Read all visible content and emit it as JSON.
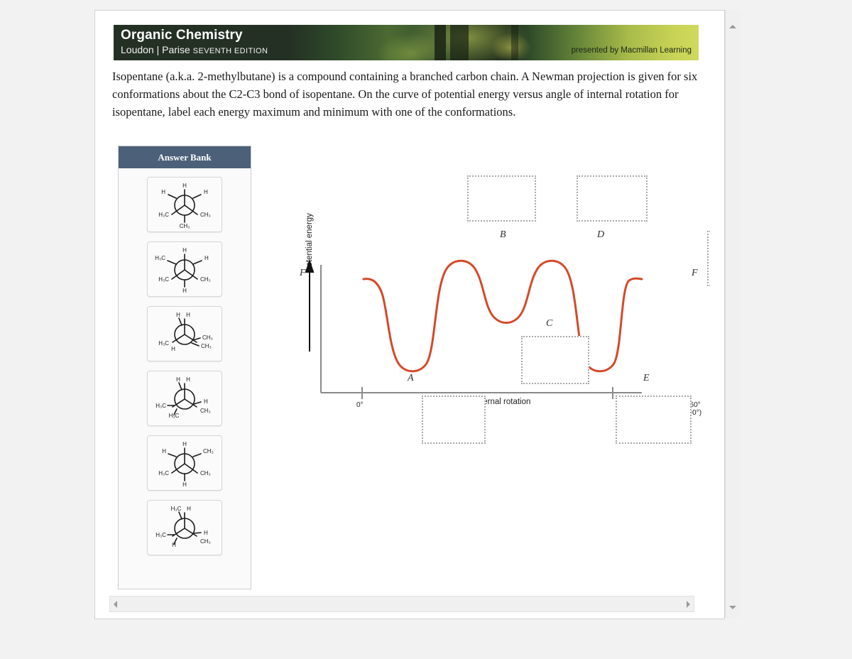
{
  "window": {
    "scroll_up_icon": "triangle-up-icon",
    "scroll_down_icon": "triangle-down-icon",
    "scroll_left_icon": "triangle-left-icon",
    "scroll_right_icon": "triangle-right-icon"
  },
  "banner": {
    "title": "Organic Chemistry",
    "authors": "Loudon | Parise",
    "edition": "SEVENTH EDITION",
    "presented_by": "presented by Macmillan Learning",
    "dark_green": "#243024",
    "light_green": "#c9d456"
  },
  "question": {
    "text": "Isopentane (a.k.a. 2-methylbutane) is a compound containing a branched carbon chain. A Newman projection is given for six conformations about the C2-C3 bond of isopentane. On the curve of potential energy versus angle of internal rotation for isopentane, label each energy maximum and minimum with one of the conformations."
  },
  "answer_bank": {
    "title": "Answer Bank",
    "header_color": "#4c6179",
    "items": [
      {
        "id": "conformation-1",
        "name": "newman-projection-staggered-1",
        "front_top": "H",
        "front_left": "H₃C",
        "front_right": "CH₃",
        "back_upper_left": "H",
        "back_upper_right": "H",
        "back_bottom": "CH₃",
        "type": "staggered"
      },
      {
        "id": "conformation-2",
        "name": "newman-projection-eclipsed-2",
        "front_top": "H",
        "front_left": "H₃C",
        "front_right": "CH₃",
        "back_upper_left": "H₃C",
        "back_upper_right": "H",
        "back_bottom": "H",
        "type": "eclipsed"
      },
      {
        "id": "conformation-3",
        "name": "newman-projection-eclipsed-3",
        "front_top": "H",
        "back_top": "H",
        "front_right": "CH₃",
        "back_right": "CH₃",
        "front_left": "H₃C",
        "back_left": "H",
        "type": "eclipsed"
      },
      {
        "id": "conformation-4",
        "name": "newman-projection-eclipsed-4",
        "front_top": "H",
        "back_top": "H",
        "front_right": "H",
        "back_right": "CH₃",
        "front_left": "H₃C",
        "back_left": "H₃C",
        "type": "eclipsed"
      },
      {
        "id": "conformation-5",
        "name": "newman-projection-staggered-5",
        "front_top": "H",
        "back_upper_left": "H",
        "back_upper_right": "CH₃",
        "front_left": "H₃C",
        "front_right": "CH₃",
        "back_bottom": "H",
        "type": "staggered"
      },
      {
        "id": "conformation-6",
        "name": "newman-projection-eclipsed-6",
        "front_top": "H",
        "back_top": "H₃C",
        "front_right": "CH₃",
        "back_right": "H",
        "front_left": "H₃C",
        "back_left": "H",
        "type": "eclipsed"
      }
    ]
  },
  "chart_data": {
    "type": "line",
    "title": "",
    "xlabel": "angle of internal rotation",
    "ylabel": "potential energy",
    "x_tick_labels": [
      "0°",
      "360° (=0°)"
    ],
    "grid": false,
    "legend": "none",
    "curve_color": "#d4492a",
    "axis_color": "#8a8a8a",
    "xlim": [
      0,
      360
    ],
    "ylim": [
      0,
      100
    ],
    "annotations": [
      {
        "label": "F",
        "x": 0,
        "y": 57,
        "position": "left-start"
      },
      {
        "label": "A",
        "x": 60,
        "y": 9,
        "position": "minimum"
      },
      {
        "label": "B",
        "x": 120,
        "y": 92,
        "position": "maximum"
      },
      {
        "label": "C",
        "x": 180,
        "y": 39,
        "position": "minimum"
      },
      {
        "label": "D",
        "x": 240,
        "y": 92,
        "position": "maximum"
      },
      {
        "label": "E",
        "x": 300,
        "y": 9,
        "position": "minimum"
      },
      {
        "label": "F",
        "x": 360,
        "y": 57,
        "position": "right-end"
      }
    ],
    "x": [
      0,
      20,
      40,
      60,
      80,
      100,
      120,
      140,
      160,
      180,
      200,
      220,
      240,
      260,
      280,
      300,
      320,
      340,
      360
    ],
    "y": [
      57,
      54,
      30,
      9,
      12,
      62,
      92,
      80,
      47,
      39,
      47,
      80,
      92,
      62,
      18,
      9,
      26,
      52,
      57
    ]
  },
  "dropzones": [
    {
      "id": "dropzone-B",
      "name": "dropzone-maximum-b",
      "for_label": "B",
      "value": "",
      "placeholder": ""
    },
    {
      "id": "dropzone-D",
      "name": "dropzone-maximum-d",
      "for_label": "D",
      "value": "",
      "placeholder": ""
    },
    {
      "id": "dropzone-F",
      "name": "dropzone-endpoint-f",
      "for_label": "F",
      "value": "",
      "placeholder": ""
    },
    {
      "id": "dropzone-C",
      "name": "dropzone-minimum-c",
      "for_label": "C",
      "value": "",
      "placeholder": ""
    },
    {
      "id": "dropzone-A",
      "name": "dropzone-minimum-a",
      "for_label": "A",
      "value": "",
      "placeholder": ""
    },
    {
      "id": "dropzone-E",
      "name": "dropzone-minimum-e",
      "for_label": "E",
      "value": "",
      "placeholder": ""
    }
  ]
}
